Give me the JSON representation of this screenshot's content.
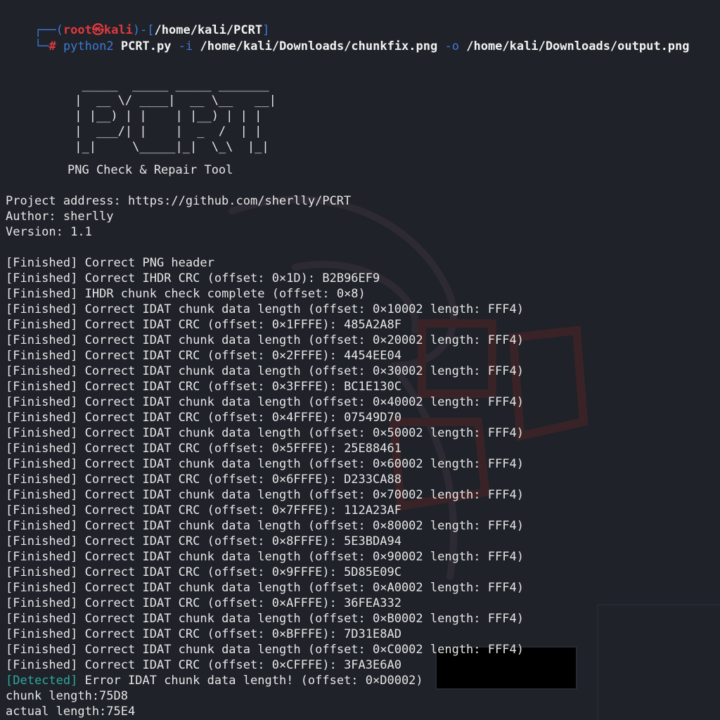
{
  "prompt": {
    "corner_top": "┌──(",
    "user": "root",
    "skull": "㉿",
    "host": "kali",
    "path_open": ")-[",
    "path": "/home/kali/PCRT",
    "path_close": "]",
    "corner_bottom": "└─",
    "hash": "#",
    "cmd": "python2",
    "script": "PCRT.py",
    "flag_i": "-i",
    "input_path": "/home/kali/Downloads/chunkfix.png",
    "flag_o": "-o",
    "output_path": "/home/kali/Downloads/output.png"
  },
  "banner": {
    "ascii_art": "  _____  _____ _____ _______\n |  __ \\/ ____|  __ \\__   __|\n | |__) | |    | |__) | | |\n |  ___/| |    |  _  /  | |\n |_|     \\_____|_|  \\_\\  |_|",
    "subtitle": "PNG Check & Repair Tool"
  },
  "info": {
    "project_address": "Project address: https://github.com/sherlly/PCRT",
    "author": "Author: sherlly",
    "version": "Version: 1.1"
  },
  "log": [
    {
      "tag": "[Finished]",
      "text": "Correct PNG header"
    },
    {
      "tag": "[Finished]",
      "text": "Correct IHDR CRC (offset: 0×1D): B2B96EF9"
    },
    {
      "tag": "[Finished]",
      "text": "IHDR chunk check complete (offset: 0×8)"
    },
    {
      "tag": "[Finished]",
      "text": "Correct IDAT chunk data length (offset: 0×10002 length: FFF4)"
    },
    {
      "tag": "[Finished]",
      "text": "Correct IDAT CRC (offset: 0×1FFFE): 485A2A8F"
    },
    {
      "tag": "[Finished]",
      "text": "Correct IDAT chunk data length (offset: 0×20002 length: FFF4)"
    },
    {
      "tag": "[Finished]",
      "text": "Correct IDAT CRC (offset: 0×2FFFE): 4454EE04"
    },
    {
      "tag": "[Finished]",
      "text": "Correct IDAT chunk data length (offset: 0×30002 length: FFF4)"
    },
    {
      "tag": "[Finished]",
      "text": "Correct IDAT CRC (offset: 0×3FFFE): BC1E130C"
    },
    {
      "tag": "[Finished]",
      "text": "Correct IDAT chunk data length (offset: 0×40002 length: FFF4)"
    },
    {
      "tag": "[Finished]",
      "text": "Correct IDAT CRC (offset: 0×4FFFE): 07549D70"
    },
    {
      "tag": "[Finished]",
      "text": "Correct IDAT chunk data length (offset: 0×50002 length: FFF4)"
    },
    {
      "tag": "[Finished]",
      "text": "Correct IDAT CRC (offset: 0×5FFFE): 25E88461"
    },
    {
      "tag": "[Finished]",
      "text": "Correct IDAT chunk data length (offset: 0×60002 length: FFF4)"
    },
    {
      "tag": "[Finished]",
      "text": "Correct IDAT CRC (offset: 0×6FFFE): D233CA88"
    },
    {
      "tag": "[Finished]",
      "text": "Correct IDAT chunk data length (offset: 0×70002 length: FFF4)"
    },
    {
      "tag": "[Finished]",
      "text": "Correct IDAT CRC (offset: 0×7FFFE): 112A23AF"
    },
    {
      "tag": "[Finished]",
      "text": "Correct IDAT chunk data length (offset: 0×80002 length: FFF4)"
    },
    {
      "tag": "[Finished]",
      "text": "Correct IDAT CRC (offset: 0×8FFFE): 5E3BDA94"
    },
    {
      "tag": "[Finished]",
      "text": "Correct IDAT chunk data length (offset: 0×90002 length: FFF4)"
    },
    {
      "tag": "[Finished]",
      "text": "Correct IDAT CRC (offset: 0×9FFFE): 5D85E09C"
    },
    {
      "tag": "[Finished]",
      "text": "Correct IDAT chunk data length (offset: 0×A0002 length: FFF4)"
    },
    {
      "tag": "[Finished]",
      "text": "Correct IDAT CRC (offset: 0×AFFFE): 36FEA332"
    },
    {
      "tag": "[Finished]",
      "text": "Correct IDAT chunk data length (offset: 0×B0002 length: FFF4)"
    },
    {
      "tag": "[Finished]",
      "text": "Correct IDAT CRC (offset: 0×BFFFE): 7D31E8AD"
    },
    {
      "tag": "[Finished]",
      "text": "Correct IDAT chunk data length (offset: 0×C0002 length: FFF4)"
    },
    {
      "tag": "[Finished]",
      "text": "Correct IDAT CRC (offset: 0×CFFFE): 3FA3E6A0"
    },
    {
      "tag": "[Detected]",
      "text": "Error IDAT chunk data length! (offset: 0×D0002)"
    }
  ],
  "tail": {
    "chunk_length": "chunk length:75D8",
    "actual_length": "actual length:75E4"
  },
  "colors": {
    "background": "#1f2229",
    "prompt_blue": "#3d7ad6",
    "prompt_red": "#e0393e",
    "detected_teal": "#2ea89c",
    "text": "#e6e6e6"
  }
}
